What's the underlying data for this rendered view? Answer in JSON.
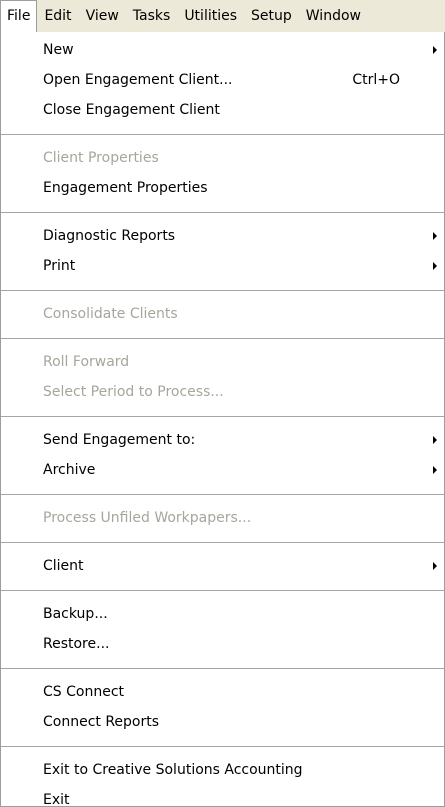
{
  "menubar": {
    "items": [
      {
        "label": "File"
      },
      {
        "label": "Edit"
      },
      {
        "label": "View"
      },
      {
        "label": "Tasks"
      },
      {
        "label": "Utilities"
      },
      {
        "label": "Setup"
      },
      {
        "label": "Window"
      }
    ]
  },
  "file_menu": {
    "new": "New",
    "open_client": "Open Engagement Client...",
    "open_client_shortcut": "Ctrl+O",
    "close_client": "Close Engagement Client",
    "client_properties": "Client Properties",
    "engagement_properties": "Engagement Properties",
    "diagnostic_reports": "Diagnostic Reports",
    "print": "Print",
    "consolidate_clients": "Consolidate Clients",
    "roll_forward": "Roll Forward",
    "select_period": "Select Period to Process...",
    "send_engagement": "Send Engagement to:",
    "archive": "Archive",
    "process_unfiled": "Process Unfiled Workpapers...",
    "client": "Client",
    "backup": "Backup...",
    "restore": "Restore...",
    "cs_connect": "CS Connect",
    "connect_reports": "Connect Reports",
    "exit_to_csa": "Exit to Creative Solutions Accounting",
    "exit": "Exit"
  },
  "colors": {
    "menubar_bg": "#ece9d8",
    "disabled_text": "#a7a69b",
    "border": "#9d9d9d"
  }
}
